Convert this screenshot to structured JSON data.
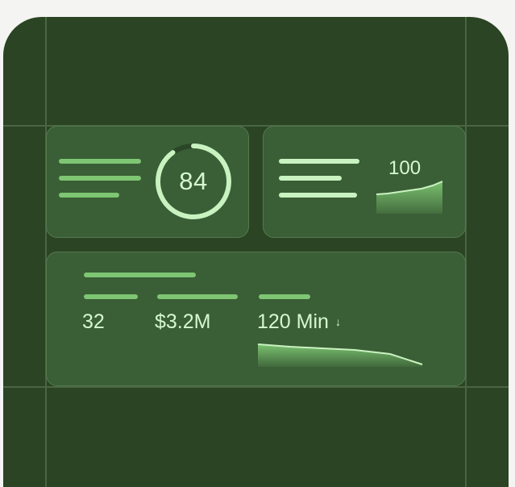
{
  "score_card": {
    "ring_value": "84",
    "ring_progress": 0.9
  },
  "trend_card": {
    "value": "100"
  },
  "stats_card": {
    "count": "32",
    "amount": "$3.2M",
    "duration": "120 Min",
    "duration_arrow": "↓"
  },
  "colors": {
    "background": "#2a4424",
    "card": "#3a5e35",
    "accent_light": "#c9f2c1",
    "accent_mid": "#7ec673",
    "text": "#d7f8cf"
  }
}
